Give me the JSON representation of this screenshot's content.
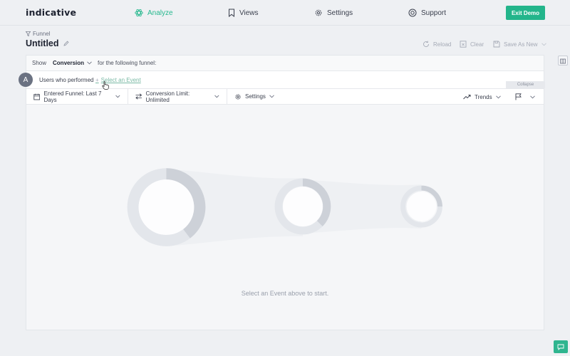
{
  "app": {
    "logo": "indicative"
  },
  "nav": {
    "analyze": "Analyze",
    "views": "Views",
    "settings": "Settings",
    "support": "Support",
    "exit_demo": "Exit Demo"
  },
  "header": {
    "breadcrumb": "Funnel",
    "title": "Untitled",
    "reload": "Reload",
    "clear": "Clear",
    "save_as_new": "Save As New"
  },
  "query": {
    "show_label": "Show",
    "metric": "Conversion",
    "after_metric": "for the following funnel:",
    "step_letter": "A",
    "users_text": "Users who performed",
    "select_event": "Select an Event",
    "collapse": "Collapse"
  },
  "filters": {
    "entered_funnel": "Entered Funnel: Last 7 Days",
    "conversion_limit": "Conversion Limit: Unlimited",
    "settings": "Settings",
    "trends": "Trends"
  },
  "empty_state": {
    "message": "Select an Event above to start."
  },
  "colors": {
    "accent": "#23b58b",
    "ring_light": "#e3e6eb",
    "ring_dark": "#c9ced5"
  }
}
